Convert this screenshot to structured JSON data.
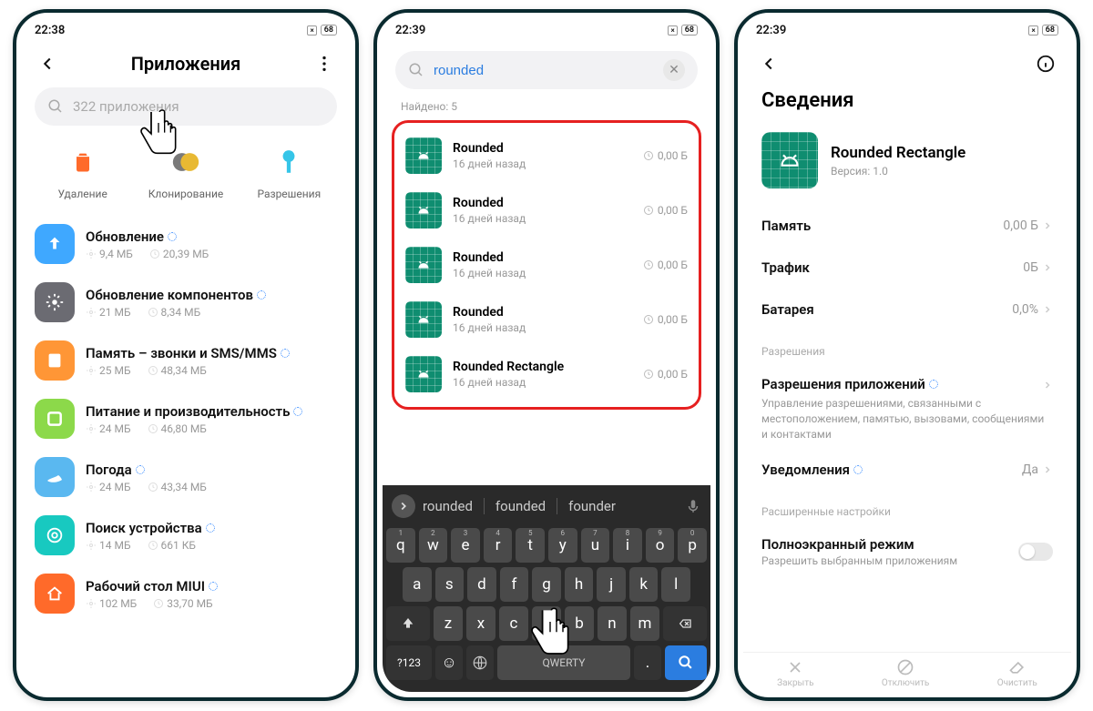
{
  "status": {
    "time1": "22:38",
    "time2": "22:39",
    "time3": "22:39",
    "battery": "68"
  },
  "phone1": {
    "title": "Приложения",
    "search_placeholder": "322 приложения",
    "actions": {
      "delete": "Удаление",
      "clone": "Клонирование",
      "perms": "Разрешения"
    },
    "apps": [
      {
        "name": "Обновление",
        "storage": "9,4 МБ",
        "data": "20,39 МБ",
        "bg": "#3fa8ff"
      },
      {
        "name": "Обновление компонентов",
        "storage": "21 МБ",
        "data": "8,34 МБ",
        "bg": "#6b6b72"
      },
      {
        "name": "Память – звонки и SMS/MMS",
        "storage": "25 МБ",
        "data": "48,34 МБ",
        "bg": "#ff9636"
      },
      {
        "name": "Питание и производительность",
        "storage": "24 МБ",
        "data": "46,80 МБ",
        "bg": "#8cd94a"
      },
      {
        "name": "Погода",
        "storage": "24 МБ",
        "data": "43,34 МБ",
        "bg": "#5ab8f0"
      },
      {
        "name": "Поиск устройства",
        "storage": "14 МБ",
        "data": "661 КБ",
        "bg": "#18c9c0"
      },
      {
        "name": "Рабочий стол MIUI",
        "storage": "102 МБ",
        "data": "33,70 МБ",
        "bg": "#ff6a2a"
      }
    ]
  },
  "phone2": {
    "search_value": "rounded",
    "found_label": "Найдено: 5",
    "results": [
      {
        "name": "Rounded",
        "age": "16 дней назад",
        "size": "0,00 Б"
      },
      {
        "name": "Rounded",
        "age": "16 дней назад",
        "size": "0,00 Б"
      },
      {
        "name": "Rounded",
        "age": "16 дней назад",
        "size": "0,00 Б"
      },
      {
        "name": "Rounded",
        "age": "16 дней назад",
        "size": "0,00 Б"
      },
      {
        "name": "Rounded Rectangle",
        "age": "16 дней назад",
        "size": "0,00 Б"
      }
    ],
    "keyboard": {
      "suggest": [
        "rounded",
        "founded",
        "founder"
      ],
      "row1": [
        "q",
        "w",
        "e",
        "r",
        "t",
        "y",
        "u",
        "i",
        "o",
        "p"
      ],
      "nums": [
        "1",
        "2",
        "3",
        "4",
        "5",
        "6",
        "7",
        "8",
        "9",
        "0"
      ],
      "row2": [
        "a",
        "s",
        "d",
        "f",
        "g",
        "h",
        "j",
        "k",
        "l"
      ],
      "row3": [
        "z",
        "x",
        "c",
        "v",
        "b",
        "n",
        "m"
      ],
      "space": "QWERTY",
      "sym": "?123"
    }
  },
  "phone3": {
    "page_title": "Сведения",
    "app_name": "Rounded Rectangle",
    "version": "Версия: 1.0",
    "rows": {
      "memory_label": "Память",
      "memory_val": "0,00 Б",
      "traffic_label": "Трафик",
      "traffic_val": "0Б",
      "battery_label": "Батарея",
      "battery_val": "0,0%"
    },
    "sections": {
      "perms_header": "Разрешения",
      "perms_title": "Разрешения приложений",
      "perms_desc": "Управление разрешениями, связанными с местоположением, памятью, вызовами, сообщениями и контактами",
      "notif_label": "Уведомления",
      "notif_val": "Да",
      "adv_header": "Расширенные настройки",
      "fullscreen_title": "Полноэкранный режим",
      "fullscreen_desc": "Разрешить выбранным приложениям"
    },
    "actions": {
      "close": "Закрыть",
      "disable": "Отключить",
      "clear": "Очистить"
    }
  }
}
